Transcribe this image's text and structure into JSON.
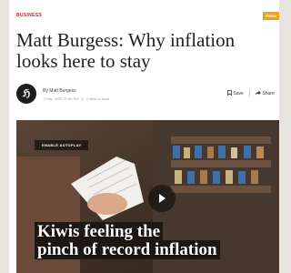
{
  "article": {
    "section": "BUSINESS",
    "badge": "PREM",
    "headline": "Matt Burgess: Why inflation looks here to stay",
    "author": "By Matt Burgess",
    "date": "1 Feb, 2022 07:00 PM",
    "read_time": "3 mins to read",
    "save_label": "Save",
    "share_label": "Share"
  },
  "video": {
    "autoplay_label": "ENABLE AUTOPLAY",
    "caption_line1": "Kiwis feeling the",
    "caption_line2": "pinch of record inflation"
  },
  "icons": {
    "avatar": "nzherald-logo",
    "save": "bookmark-icon",
    "share": "share-arrow-icon",
    "play": "play-icon"
  },
  "colors": {
    "section": "#c4262e",
    "badge": "#f2a313",
    "headline": "#222222"
  }
}
